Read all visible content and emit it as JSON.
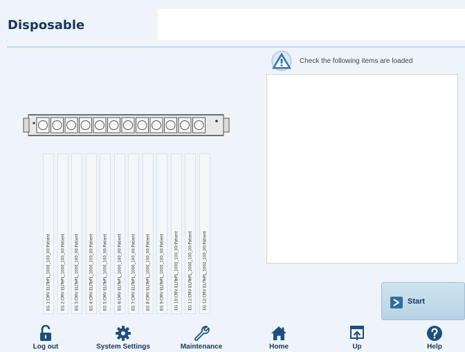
{
  "header": {
    "title": "Disposable"
  },
  "loading_panel": {
    "message": "Check the following items are loaded",
    "icon": "warning-icon"
  },
  "cartridge_rack": {
    "slot_count": 12,
    "labels": [
      "EG 1:CMV ELITePL_1000_100_00:Patient",
      "EG 2:CMV ELITePL_1000_100_00:Patient",
      "EG 3:CMV ELITePL_1000_100_00:Patient",
      "EG 4:CMV ELITePL_1000_100_00:Patient",
      "EG 5:CMV ELITePL_1000_100_00:Patient",
      "EG 6:CMV ELITePL_1000_100_00:Patient",
      "EG 7:CMV ELITePL_1000_100_00:Patient",
      "EG 8:CMV ELITePL_1000_100_00:Patient",
      "EG 9:CMV ELITePL_1000_100_00:Patient",
      "EG 10:CMV ELITePL_1000_100_00:Patient",
      "EG 11:CMV ELITePL_1000_100_00:Patient",
      "EG 12:CMV ELITePL_1000_100_00:Patient"
    ]
  },
  "start_button": {
    "label": "Start",
    "icon": "play-icon"
  },
  "nav": {
    "logout": "Log out",
    "system_settings": "System Settings",
    "maintenance": "Maintenance",
    "home": "Home",
    "up": "Up",
    "help": "Help"
  },
  "colors": {
    "accent": "#2f6f9c",
    "text": "#17365d",
    "background": "#eef4f9"
  }
}
